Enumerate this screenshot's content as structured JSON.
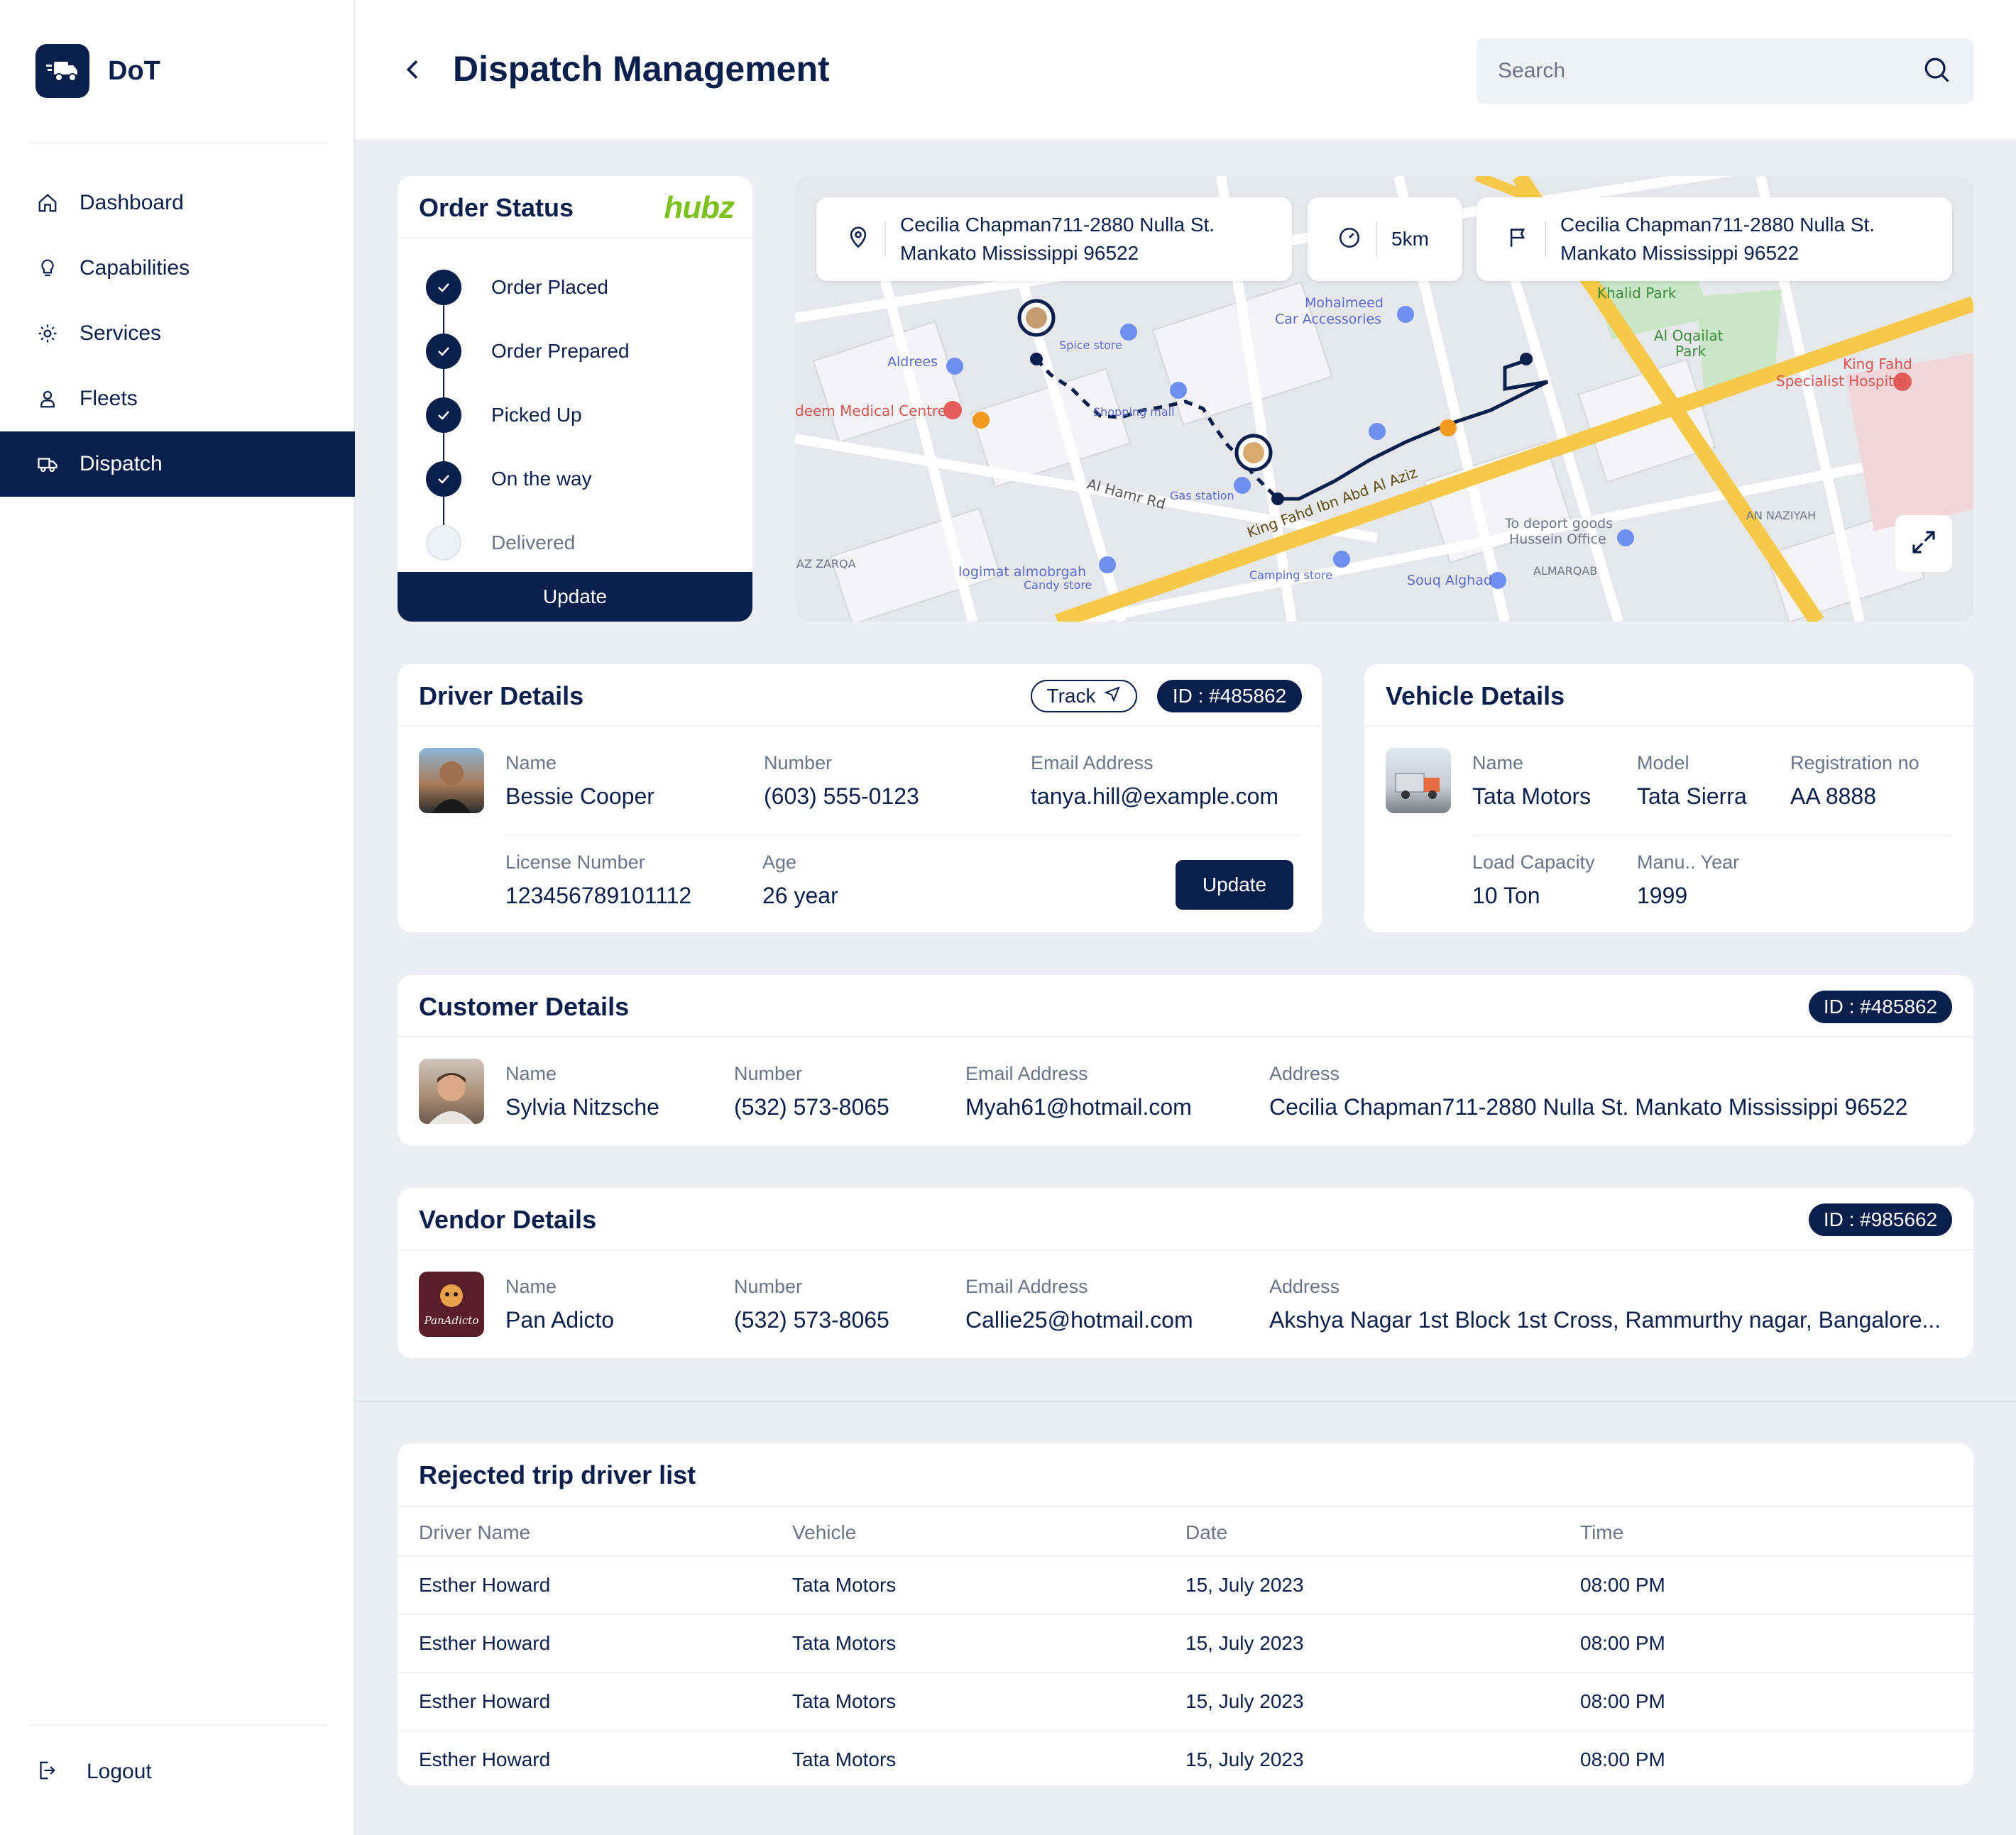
{
  "brand": {
    "name": "DoT"
  },
  "nav": [
    {
      "label": "Dashboard",
      "icon": "home-icon"
    },
    {
      "label": "Capabilities",
      "icon": "lightbulb-icon"
    },
    {
      "label": "Services",
      "icon": "gear-icon"
    },
    {
      "label": "Fleets",
      "icon": "user-icon"
    },
    {
      "label": "Dispatch",
      "icon": "truck-icon",
      "active": true
    }
  ],
  "logout_label": "Logout",
  "header": {
    "title": "Dispatch Management",
    "search_placeholder": "Search"
  },
  "order_status": {
    "title": "Order Status",
    "vendor_logo_text": "hubz",
    "steps": [
      {
        "label": "Order Placed",
        "done": true
      },
      {
        "label": "Order Prepared",
        "done": true
      },
      {
        "label": "Picked Up",
        "done": true
      },
      {
        "label": "On the way",
        "done": true
      },
      {
        "label": "Delivered",
        "done": false
      }
    ],
    "update_label": "Update"
  },
  "map": {
    "origin_line1": "Cecilia Chapman711-2880 Nulla St.",
    "origin_line2": "Mankato Mississippi 96522",
    "distance": "5km",
    "destination_line1": "Cecilia Chapman711-2880 Nulla St.",
    "destination_line2": "Mankato Mississippi 96522",
    "labels": {
      "road1": "King Fahd Ibn Abd Al Aziz",
      "road2": "Al Hamr Rd",
      "poi1": "Mohaimeed",
      "poi1b": "Car Accessories",
      "poi2": "Khalid Park",
      "poi3": "Al Oqailat",
      "poi3b": "Park",
      "poi4": "King Fahd",
      "poi4b": "Specialist Hospital",
      "poi5": "Aldrees",
      "poi6": "deem Medical Centre",
      "poi7": "logimat almobrgah",
      "poi7b": "Candy store",
      "poi8": "To deport goods",
      "poi8b": "Hussein Office",
      "poi9": "Souq Alghad",
      "poi10": "AN NAZIYAH",
      "poi11": "ALMARQAB",
      "poi12": "AZ ZARQA",
      "poi13": "Spice store",
      "poi14": "Gas station",
      "poi15": "Camping store",
      "poi16": "Shopping mall"
    }
  },
  "driver": {
    "title": "Driver Details",
    "track_label": "Track",
    "id": "ID : #485862",
    "name_label": "Name",
    "name": "Bessie Cooper",
    "number_label": "Number",
    "number": "(603) 555-0123",
    "email_label": "Email Address",
    "email": "tanya.hill@example.com",
    "license_label": "License Number",
    "license": "123456789101112",
    "age_label": "Age",
    "age": "26 year",
    "update_label": "Update"
  },
  "vehicle": {
    "title": "Vehicle Details",
    "name_label": "Name",
    "name": "Tata Motors",
    "model_label": "Model",
    "model": "Tata Sierra",
    "reg_label": "Registration no",
    "reg": "AA 8888",
    "load_label": "Load Capacity",
    "load": "10 Ton",
    "year_label": "Manu.. Year",
    "year": "1999"
  },
  "customer": {
    "title": "Customer Details",
    "id": "ID : #485862",
    "name_label": "Name",
    "name": "Sylvia Nitzsche",
    "number_label": "Number",
    "number": "(532) 573-8065",
    "email_label": "Email Address",
    "email": "Myah61@hotmail.com",
    "address_label": "Address",
    "address": "Cecilia Chapman711-2880 Nulla St. Mankato Mississippi 96522"
  },
  "vendor": {
    "title": "Vendor Details",
    "id": "ID : #985662",
    "logo_text": "PanAdicto",
    "name_label": "Name",
    "name": "Pan Adicto",
    "number_label": "Number",
    "number": "(532) 573-8065",
    "email_label": "Email Address",
    "email": "Callie25@hotmail.com",
    "address_label": "Address",
    "address": "Akshya Nagar 1st Block 1st Cross, Rammurthy nagar, Bangalore..."
  },
  "rejected": {
    "title": "Rejected trip driver list",
    "columns": [
      "Driver Name",
      "Vehicle",
      "Date",
      "Time"
    ],
    "rows": [
      [
        "Esther Howard",
        "Tata Motors",
        "15, July 2023",
        "08:00 PM"
      ],
      [
        "Esther Howard",
        "Tata Motors",
        "15, July 2023",
        "08:00 PM"
      ],
      [
        "Esther Howard",
        "Tata Motors",
        "15, July 2023",
        "08:00 PM"
      ],
      [
        "Esther Howard",
        "Tata Motors",
        "15, July 2023",
        "08:00 PM"
      ]
    ]
  },
  "colors": {
    "primary": "#0b1f4d",
    "background": "#eceef3",
    "muted": "#6b7486",
    "route_yellow": "#f7c948",
    "brand_green": "#7cc11c"
  }
}
